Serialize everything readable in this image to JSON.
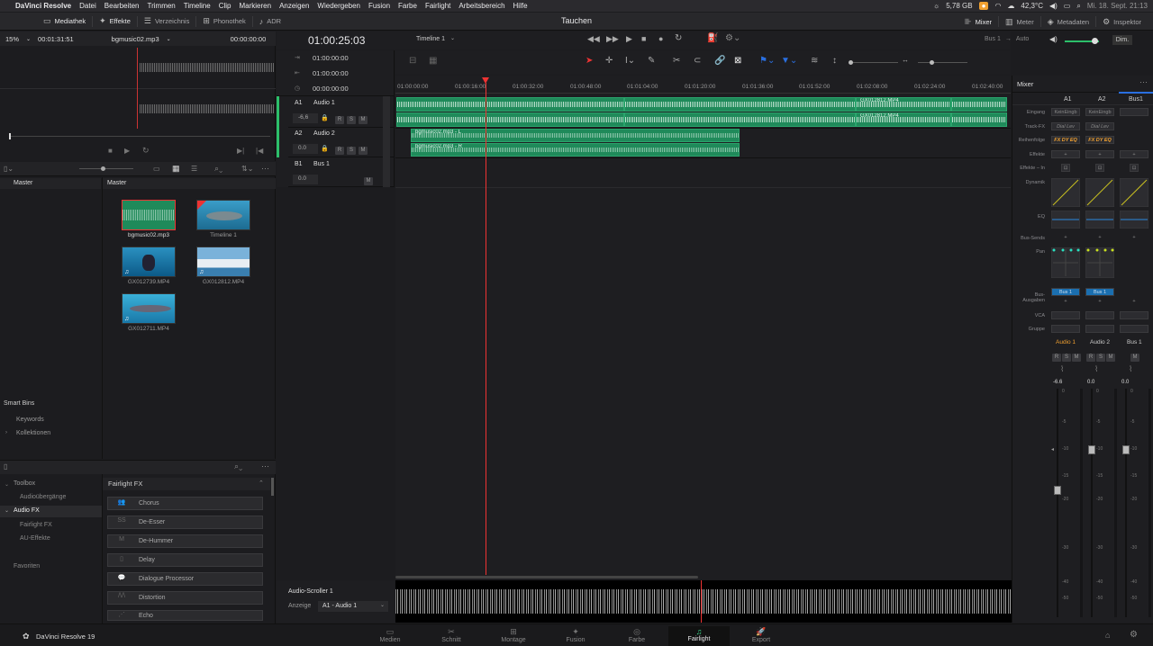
{
  "menubar": {
    "app": "DaVinci Resolve",
    "items": [
      "Datei",
      "Bearbeiten",
      "Trimmen",
      "Timeline",
      "Clip",
      "Markieren",
      "Anzeigen",
      "Wiedergeben",
      "Fusion",
      "Farbe",
      "Fairlight",
      "Arbeitsbereich",
      "Hilfe"
    ],
    "storage": "5,78 GB",
    "temp": "42,3°C",
    "datetime": "Mi. 18. Sept. 21:13"
  },
  "toolbar": {
    "left": [
      "Mediathek",
      "Effekte",
      "Verzeichnis",
      "Phonothek",
      "ADR"
    ],
    "title": "Tauchen",
    "right": [
      "Mixer",
      "Meter",
      "Metadaten",
      "Inspektor"
    ]
  },
  "viewer": {
    "zoom": "15%",
    "timecode_left": "00:01:31:51",
    "clip_name": "bgmusic02.mp3",
    "timecode_right": "00:00:00:00"
  },
  "transport": {
    "timecode": "01:00:25:03",
    "timeline_name": "Timeline 1",
    "bus": "Bus 1",
    "arrow": "→",
    "auto": "Auto",
    "dim": "Dim."
  },
  "timecodes": [
    "01:00:00:00",
    "01:00:00:00",
    "00:00:00:00"
  ],
  "tracks": [
    {
      "id": "A1",
      "name": "Audio 1",
      "value": "-6,6"
    },
    {
      "id": "A2",
      "name": "Audio 2",
      "value": "0.0"
    },
    {
      "id": "B1",
      "name": "Bus 1",
      "value": "0.0"
    }
  ],
  "track_buttons": [
    "R",
    "S",
    "M"
  ],
  "ruler": [
    "01:00:00:00",
    "01:00:16:00",
    "01:00:32:00",
    "01:00:48:00",
    "01:01:04:00",
    "01:01:20:00",
    "01:01:36:00",
    "01:01:52:00",
    "01:02:08:00",
    "01:02:24:00",
    "01:02:40:00"
  ],
  "clips": {
    "a2_label_1": "bgmusic02.mp3 - L",
    "a2_label_2": "bgmusic02.mp3 - R",
    "a1_mid_label": "GX012812.MP4"
  },
  "media": {
    "left_header": "Master",
    "right_header": "Master",
    "items": [
      {
        "name": "bgmusic02.mp3"
      },
      {
        "name": "Timeline 1"
      },
      {
        "name": "GX012739.MP4"
      },
      {
        "name": "GX012812.MP4"
      },
      {
        "name": "GX012711.MP4"
      }
    ],
    "smart_bins": "Smart Bins",
    "smart_items": [
      "Keywords",
      "Kollektionen"
    ]
  },
  "effects": {
    "tree": [
      "Toolbox",
      "Audioübergänge",
      "Audio FX",
      "Fairlight FX",
      "AU-Effekte",
      "Favoriten"
    ],
    "header": "Fairlight FX",
    "list": [
      "Chorus",
      "De-Esser",
      "De-Hummer",
      "Delay",
      "Dialogue Processor",
      "Distortion",
      "Echo"
    ],
    "icons": [
      "SS",
      "M"
    ]
  },
  "scroller": {
    "title": "Audio-Scroller 1",
    "label": "Anzeige",
    "value": "A1 - Audio 1"
  },
  "mixer": {
    "title": "Mixer",
    "columns": [
      "A1",
      "A2",
      "Bus1"
    ],
    "rows": [
      "Eingang",
      "Track-FX",
      "Reihenfolge",
      "Effekte",
      "Effekte – In",
      "Dynamik",
      "EQ",
      "Bus-Sends",
      "Pan",
      "Bus-Ausgaben",
      "VCA",
      "Gruppe"
    ],
    "input": [
      "KeinEingb",
      "KeinEingb"
    ],
    "trackfx": [
      "Dial Lev",
      "Dial Lev"
    ],
    "order": [
      "FX DY EQ",
      "FX DY EQ"
    ],
    "bus_out": [
      "Bus 1",
      "Bus 1"
    ],
    "strip_names": [
      "Audio 1",
      "Audio 2",
      "Bus 1"
    ],
    "fader_values": [
      "-6.6",
      "0.0",
      "0.0"
    ],
    "scale": [
      "0",
      "-5",
      "-10",
      "-15",
      "-20",
      "-30",
      "-40",
      "-50"
    ],
    "accent_color": "#f0a030",
    "green_color": "#1f8a5a"
  },
  "bottom": {
    "brand": "DaVinci Resolve 19",
    "pages": [
      "Medien",
      "Schnitt",
      "Montage",
      "Fusion",
      "Farbe",
      "Fairlight",
      "Export"
    ],
    "active_page": "Fairlight"
  }
}
